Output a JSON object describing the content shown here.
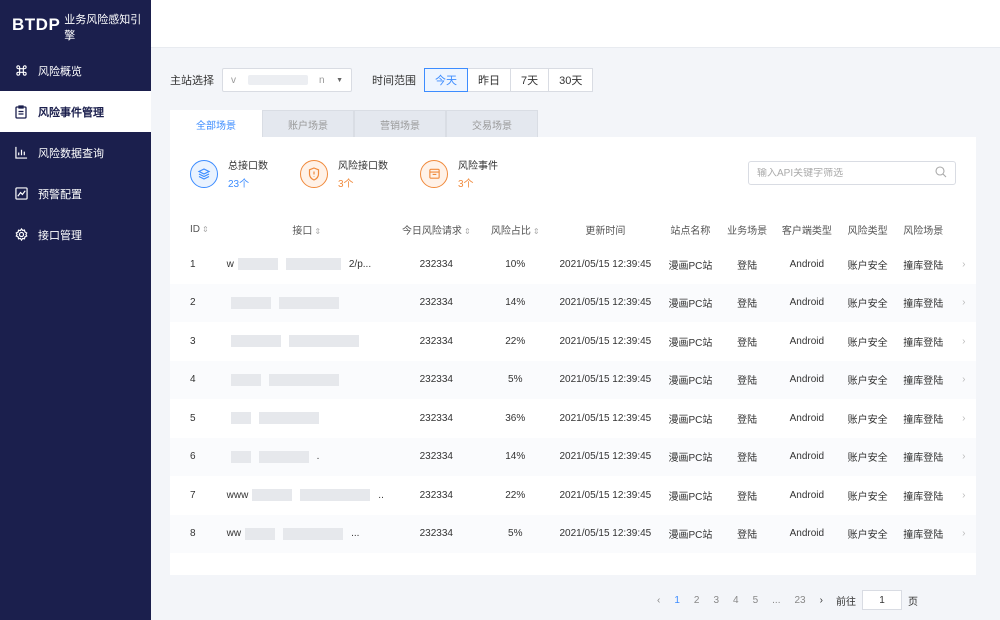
{
  "brand": {
    "main": "BTDP",
    "sub": "业务风险感知引擎"
  },
  "sidebar": {
    "items": [
      {
        "label": "风险概览",
        "icon": "command-icon"
      },
      {
        "label": "风险事件管理",
        "icon": "clipboard-icon",
        "active": true
      },
      {
        "label": "风险数据查询",
        "icon": "bar-chart-icon"
      },
      {
        "label": "预警配置",
        "icon": "alert-chart-icon"
      },
      {
        "label": "接口管理",
        "icon": "gear-icon"
      }
    ]
  },
  "filters": {
    "site_label": "主站选择",
    "site_value_prefix": "v",
    "site_value_suffix": "n",
    "time_label": "时间范围",
    "ranges": [
      "今天",
      "昨日",
      "7天",
      "30天"
    ]
  },
  "tabs": [
    "全部场景",
    "账户场景",
    "营销场景",
    "交易场景"
  ],
  "stats": [
    {
      "title": "总接口数",
      "value": "23个",
      "color": "#3c8cff"
    },
    {
      "title": "风险接口数",
      "value": "3个",
      "color": "#f08a3c"
    },
    {
      "title": "风险事件",
      "value": "3个",
      "color": "#f08a3c"
    }
  ],
  "search": {
    "placeholder": "输入API关键字筛选"
  },
  "table": {
    "headers": [
      "ID",
      "接口",
      "今日风险请求",
      "风险占比",
      "更新时间",
      "站点名称",
      "业务场景",
      "客户端类型",
      "风险类型",
      "风险场景"
    ],
    "rows": [
      {
        "id": "1",
        "api_pre": "w",
        "api_post": "2/p...",
        "req": "232334",
        "ratio": "10%",
        "time": "2021/05/15  12:39:45",
        "site": "漫画PC站",
        "biz": "登陆",
        "client": "Android",
        "rtype": "账户安全",
        "scene": "撞库登陆"
      },
      {
        "id": "2",
        "api_pre": "",
        "api_post": "",
        "req": "232334",
        "ratio": "14%",
        "time": "2021/05/15  12:39:45",
        "site": "漫画PC站",
        "biz": "登陆",
        "client": "Android",
        "rtype": "账户安全",
        "scene": "撞库登陆"
      },
      {
        "id": "3",
        "api_pre": "",
        "api_post": "",
        "req": "232334",
        "ratio": "22%",
        "time": "2021/05/15  12:39:45",
        "site": "漫画PC站",
        "biz": "登陆",
        "client": "Android",
        "rtype": "账户安全",
        "scene": "撞库登陆"
      },
      {
        "id": "4",
        "api_pre": "",
        "api_post": "",
        "req": "232334",
        "ratio": "5%",
        "time": "2021/05/15  12:39:45",
        "site": "漫画PC站",
        "biz": "登陆",
        "client": "Android",
        "rtype": "账户安全",
        "scene": "撞库登陆"
      },
      {
        "id": "5",
        "api_pre": "",
        "api_post": "",
        "req": "232334",
        "ratio": "36%",
        "time": "2021/05/15  12:39:45",
        "site": "漫画PC站",
        "biz": "登陆",
        "client": "Android",
        "rtype": "账户安全",
        "scene": "撞库登陆"
      },
      {
        "id": "6",
        "api_pre": "",
        "api_post": ".",
        "req": "232334",
        "ratio": "14%",
        "time": "2021/05/15  12:39:45",
        "site": "漫画PC站",
        "biz": "登陆",
        "client": "Android",
        "rtype": "账户安全",
        "scene": "撞库登陆"
      },
      {
        "id": "7",
        "api_pre": "www",
        "api_post": "..",
        "req": "232334",
        "ratio": "22%",
        "time": "2021/05/15  12:39:45",
        "site": "漫画PC站",
        "biz": "登陆",
        "client": "Android",
        "rtype": "账户安全",
        "scene": "撞库登陆"
      },
      {
        "id": "8",
        "api_pre": "ww",
        "api_post": "...",
        "req": "232334",
        "ratio": "5%",
        "time": "2021/05/15  12:39:45",
        "site": "漫画PC站",
        "biz": "登陆",
        "client": "Android",
        "rtype": "账户安全",
        "scene": "撞库登陆"
      }
    ]
  },
  "pager": {
    "prev": "‹",
    "pages": [
      "1",
      "2",
      "3",
      "4",
      "5",
      "...",
      "23"
    ],
    "next": "›",
    "goto_label": "前往",
    "goto_value": "1",
    "page_unit": "页"
  }
}
